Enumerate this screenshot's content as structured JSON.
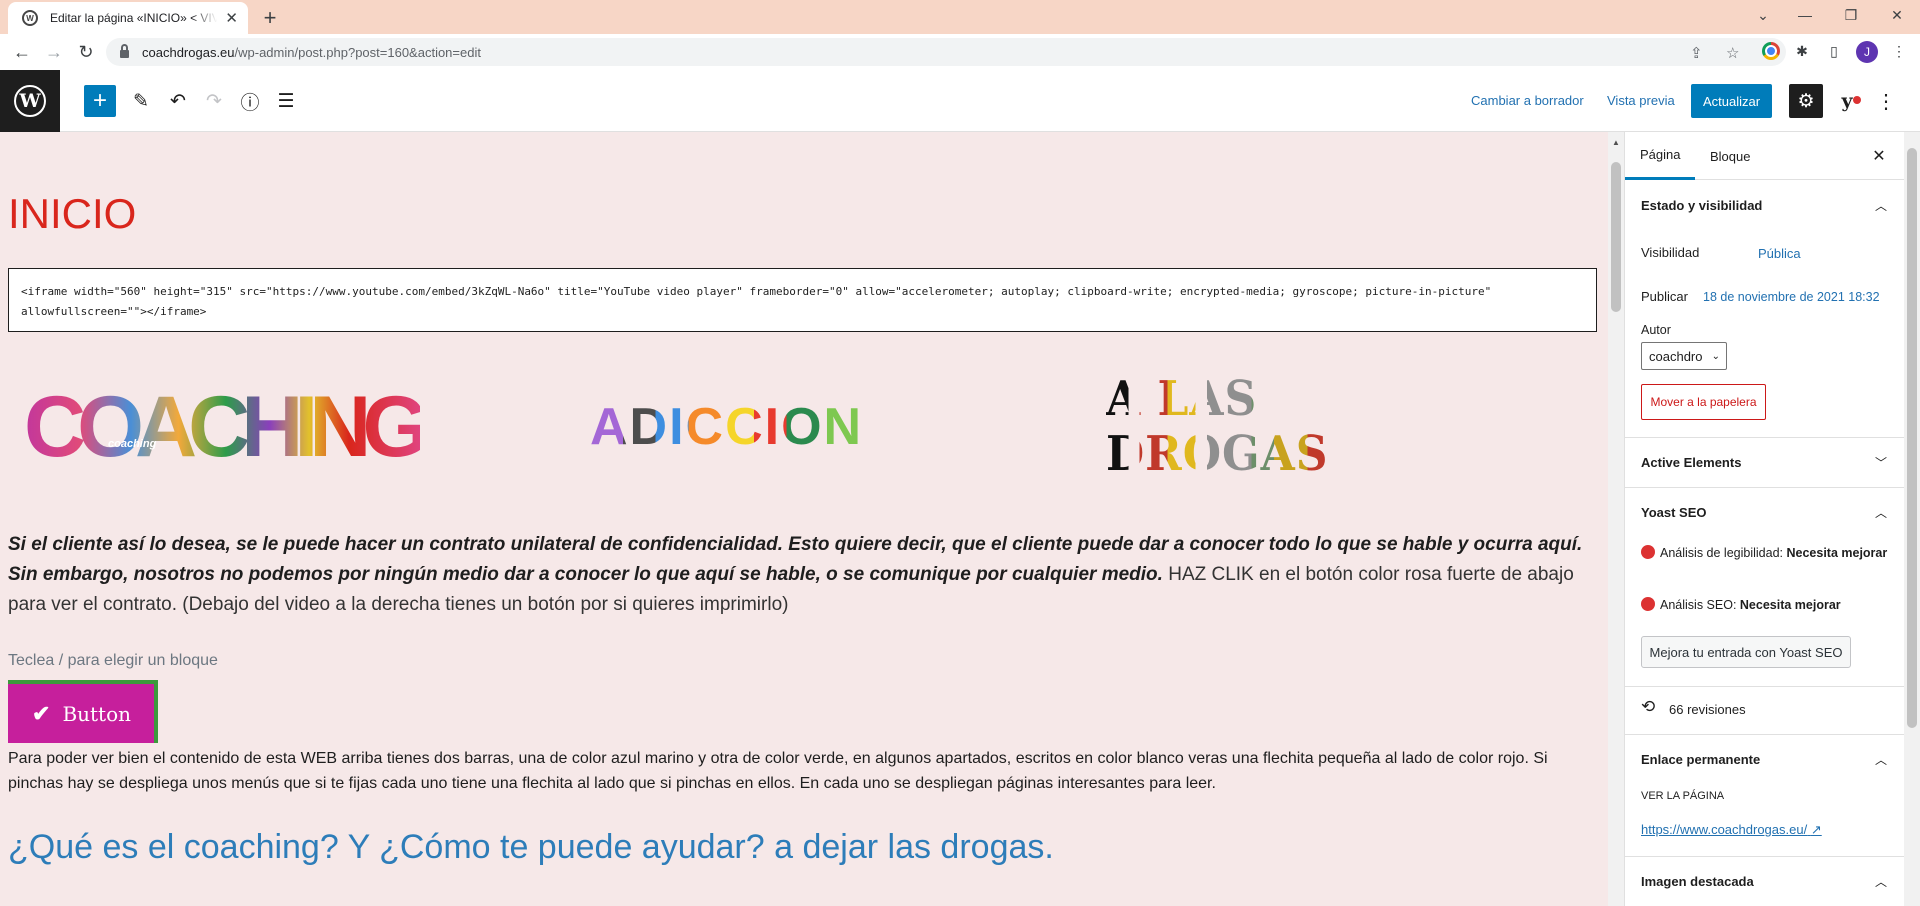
{
  "browser": {
    "tab_title": "Editar la página «INICIO» < VIVIR",
    "url_host": "coachdrogas.eu",
    "url_path": "/wp-admin/post.php?post=160&action=edit",
    "avatar_letter": "J"
  },
  "editor_header": {
    "switch_to_draft": "Cambiar a borrador",
    "preview": "Vista previa",
    "update": "Actualizar"
  },
  "content": {
    "page_title": "INICIO",
    "html_block": "<iframe width=\"560\" height=\"315\" src=\"https://www.youtube.com/embed/3kZqWL-Na6o\" title=\"YouTube video player\" frameborder=\"0\" allow=\"accelerometer; autoplay; clipboard-write; encrypted-media; gyroscope; picture-in-picture\" allowfullscreen=\"\"></iframe>",
    "logo_coaching": "COACHING",
    "logo_coaching_sub": "coaching",
    "logo_adiccion": "ADICCION",
    "logo_drogas": "A LAS DROGAS",
    "para_bold_italic": "Si el cliente así lo desea, se le puede hacer un contrato unilateral de confidencialidad. Esto quiere decir, que el cliente puede dar a conocer todo lo que se hable y ocurra aquí. Sin embargo, nosotros no podemos por ningún medio dar a conocer lo que aquí se hable, o se comunique por cualquier medio.",
    "para_normal": " HAZ CLIK en el botón color rosa fuerte de abajo para ver el contrato. (Debajo del video a la derecha tienes un botón por si quieres imprimirlo)",
    "block_placeholder": "Teclea / para elegir un bloque",
    "button_label": "Button",
    "para_second": "Para poder ver bien el contenido de esta WEB arriba tienes dos barras, una de color azul marino y otra de color verde, en algunos apartados, escritos en color blanco veras una flechita pequeña al lado de color rojo. Si pinchas hay se despliega unos menús que si te fijas cada uno tiene una flechita al lado que si pinchas en ellos. En cada uno se despliegan  páginas interesantes para leer.",
    "heading_coaching": "¿Qué es el coaching? Y ¿Cómo te puede ayudar? a dejar las drogas."
  },
  "sidebar": {
    "tab_page": "Página",
    "tab_block": "Bloque",
    "status_panel": "Estado y visibilidad",
    "visibility_label": "Visibilidad",
    "visibility_value": "Pública",
    "publish_label": "Publicar",
    "publish_value": "18 de noviembre de 2021 18:32",
    "author_label": "Autor",
    "author_value": "coachdro",
    "trash": "Mover a la papelera",
    "active_elements": "Active Elements",
    "yoast_panel": "Yoast SEO",
    "readability_label": "Análisis de legibilidad:",
    "readability_value": "Necesita mejorar",
    "seo_label": "Análisis SEO:",
    "seo_value": "Necesita mejorar",
    "yoast_button": "Mejora tu entrada con Yoast SEO",
    "revisions": "66 revisiones",
    "permalink_panel": "Enlace permanente",
    "view_page": "VER LA PÁGINA",
    "permalink_url": "https://www.coachdrogas.eu/",
    "featured_image": "Imagen destacada"
  },
  "colors": {
    "accent": "#007cba",
    "title_red": "#d9261c",
    "heading_blue": "#2d7db9",
    "button_pink": "#c61f9c",
    "canvas_bg": "#f6e8e8"
  }
}
